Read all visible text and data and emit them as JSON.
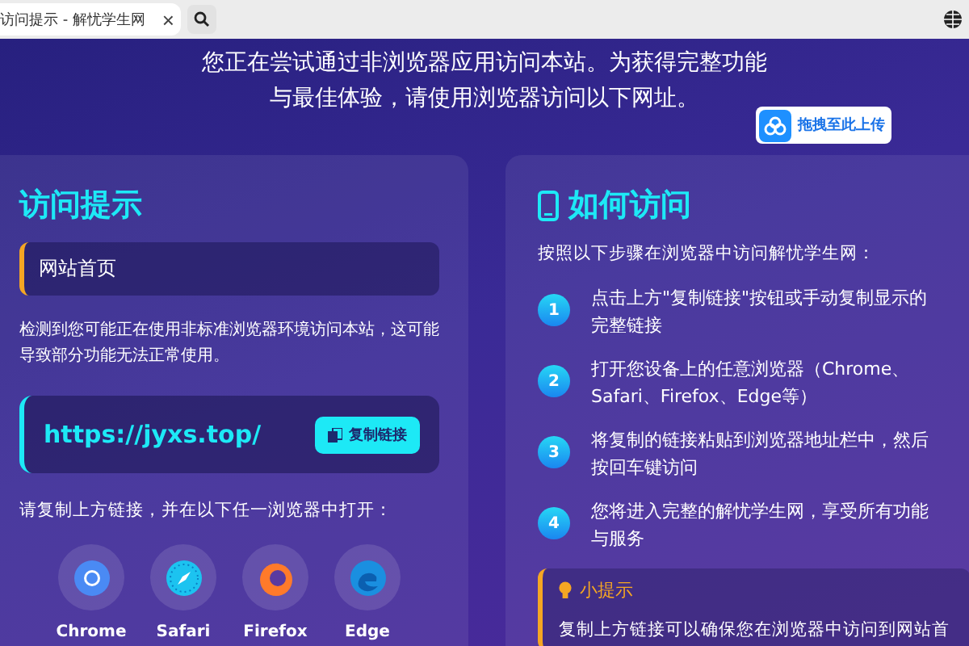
{
  "browser": {
    "tab_title": "访问提示 - 解忧学生网",
    "tab_close": "×"
  },
  "banner": {
    "message": "您正在尝试通过非浏览器应用访问本站。为获得完整功能与最佳体验，请使用浏览器访问以下网址。",
    "upload_button": "拖拽至此上传"
  },
  "notice_panel": {
    "title": "访问提示",
    "page_label": "网站首页",
    "description": "检测到您可能正在使用非标准浏览器环境访问本站，这可能导致部分功能无法正常使用。",
    "url": "https://jyxs.top/",
    "copy_button": "复制链接",
    "instruction": "请复制上方链接，并在以下任一浏览器中打开：",
    "browsers": [
      {
        "kind": "chrome",
        "name": "Chrome"
      },
      {
        "kind": "safari",
        "name": "Safari"
      },
      {
        "kind": "firefox",
        "name": "Firefox"
      },
      {
        "kind": "edge",
        "name": "Edge"
      }
    ]
  },
  "howto_panel": {
    "title": "如何访问",
    "intro": "按照以下步骤在浏览器中访问解忧学生网：",
    "steps": [
      {
        "number": "1",
        "text": "点击上方\"复制链接\"按钮或手动复制显示的完整链接"
      },
      {
        "number": "2",
        "text": "打开您设备上的任意浏览器（Chrome、Safari、Firefox、Edge等）"
      },
      {
        "number": "3",
        "text": "将复制的链接粘贴到浏览器地址栏中，然后按回车键访问"
      },
      {
        "number": "4",
        "text": "您将进入完整的解忧学生网，享受所有功能与服务"
      }
    ],
    "tip": {
      "title": "小提示",
      "text": "复制上方链接可以确保您在浏览器中访问到网站首"
    }
  }
}
